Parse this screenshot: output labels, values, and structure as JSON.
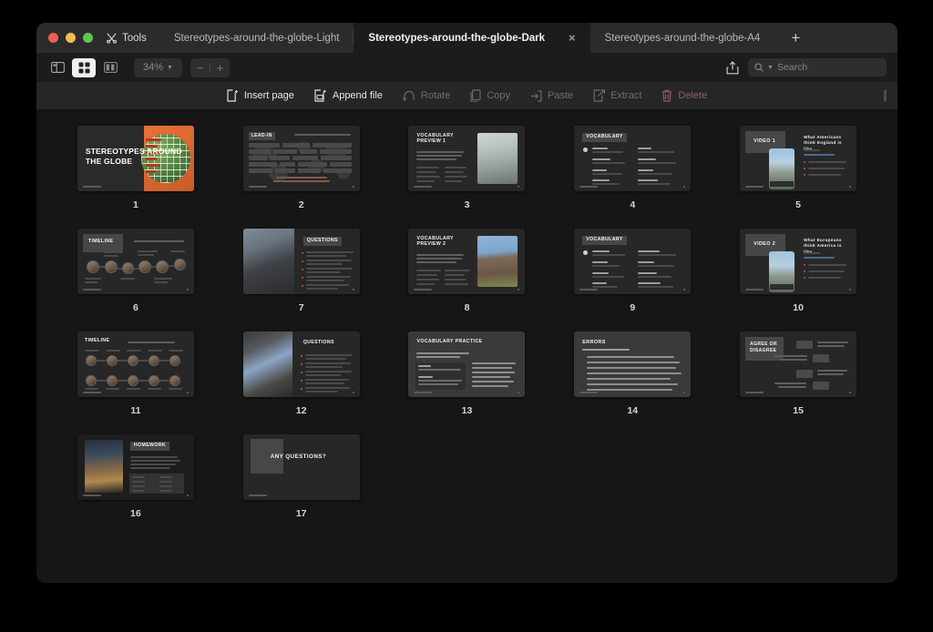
{
  "window": {
    "traffic_lights": [
      "close",
      "minimize",
      "zoom"
    ],
    "tools_label": "Tools",
    "tabs": [
      {
        "label": "Stereotypes-around-the-globe-Light",
        "active": false
      },
      {
        "label": "Stereotypes-around-the-globe-Dark",
        "active": true
      },
      {
        "label": "Stereotypes-around-the-globe-A4",
        "active": false
      }
    ],
    "new_tab_label": "+",
    "close_tab_label": "×"
  },
  "toolbar": {
    "view_sidebar_label": "Sidebar view",
    "view_grid_label": "Grid view",
    "view_twopage_label": "Two page view",
    "zoom_level": "34%",
    "zoom_out_label": "−",
    "zoom_in_label": "+",
    "share_label": "Share",
    "search_placeholder": "Search"
  },
  "actions": [
    {
      "label": "Insert page",
      "icon": "insert-page-icon",
      "state": "enabled"
    },
    {
      "label": "Append file",
      "icon": "append-file-icon",
      "state": "enabled"
    },
    {
      "label": "Rotate",
      "icon": "rotate-icon",
      "state": "disabled"
    },
    {
      "label": "Copy",
      "icon": "copy-icon",
      "state": "disabled"
    },
    {
      "label": "Paste",
      "icon": "paste-icon",
      "state": "disabled"
    },
    {
      "label": "Extract",
      "icon": "extract-icon",
      "state": "disabled"
    },
    {
      "label": "Delete",
      "icon": "delete-icon",
      "state": "disabled-destructive"
    }
  ],
  "pages": [
    {
      "num": "1",
      "title": "STEREOTYPES AROUND THE GLOBE",
      "kind": "cover"
    },
    {
      "num": "2",
      "title": "LEAD-IN",
      "kind": "leadin",
      "subtitle": "Fill in answers for how stereotypes are about Britain"
    },
    {
      "num": "3",
      "title": "VOCABULARY PREVIEW 1",
      "kind": "vocab-preview",
      "body": "Mark the words you're familiar with and provide brief explanations for them. Then, discuss the unfamiliar words on the next page."
    },
    {
      "num": "4",
      "title": "VOCABULARY",
      "kind": "vocab-list"
    },
    {
      "num": "5",
      "title": "VIDEO 1",
      "kind": "video",
      "heading": "What Americans think England is like",
      "duration": "Duration: 4:29 min"
    },
    {
      "num": "6",
      "title": "TIMELINE",
      "kind": "timeline-1",
      "subtitle": "Retell the story using the provided words and images"
    },
    {
      "num": "7",
      "title": "QUESTIONS",
      "kind": "questions-left-photo"
    },
    {
      "num": "8",
      "title": "VOCABULARY PREVIEW 2",
      "kind": "vocab-preview",
      "body": "Mark the words you're familiar with and provide brief explanations for them. Then, discuss the unfamiliar words on the next page."
    },
    {
      "num": "9",
      "title": "VOCABULARY",
      "kind": "vocab-list"
    },
    {
      "num": "10",
      "title": "VIDEO 2",
      "kind": "video",
      "heading": "What Europeans think America is like",
      "duration": "Duration: 5:15 min"
    },
    {
      "num": "11",
      "title": "TIMELINE",
      "kind": "timeline-2",
      "subtitle": "Retell the story using the provided words and images"
    },
    {
      "num": "12",
      "title": "QUESTIONS",
      "kind": "questions-right"
    },
    {
      "num": "13",
      "title": "VOCABULARY PRACTICE",
      "kind": "practice",
      "theme": "light",
      "body": "Read each short sentence and then expand it by adding more detail and context. For example:"
    },
    {
      "num": "14",
      "title": "ERRORS",
      "kind": "errors",
      "theme": "light",
      "subtitle": "Read the sentences, identify any errors, and correct them"
    },
    {
      "num": "15",
      "title": "AGREE OR DISAGREE",
      "kind": "agree",
      "theme": "light"
    },
    {
      "num": "16",
      "title": "HOMEWORK",
      "kind": "homework",
      "body": "Choose a country from page 2 and imagine a highly stereotypical day in the life there. Write a brief overview of what your typical day would look like based on that stereotype."
    },
    {
      "num": "17",
      "title": "ANY QUESTIONS?",
      "kind": "closing"
    }
  ]
}
